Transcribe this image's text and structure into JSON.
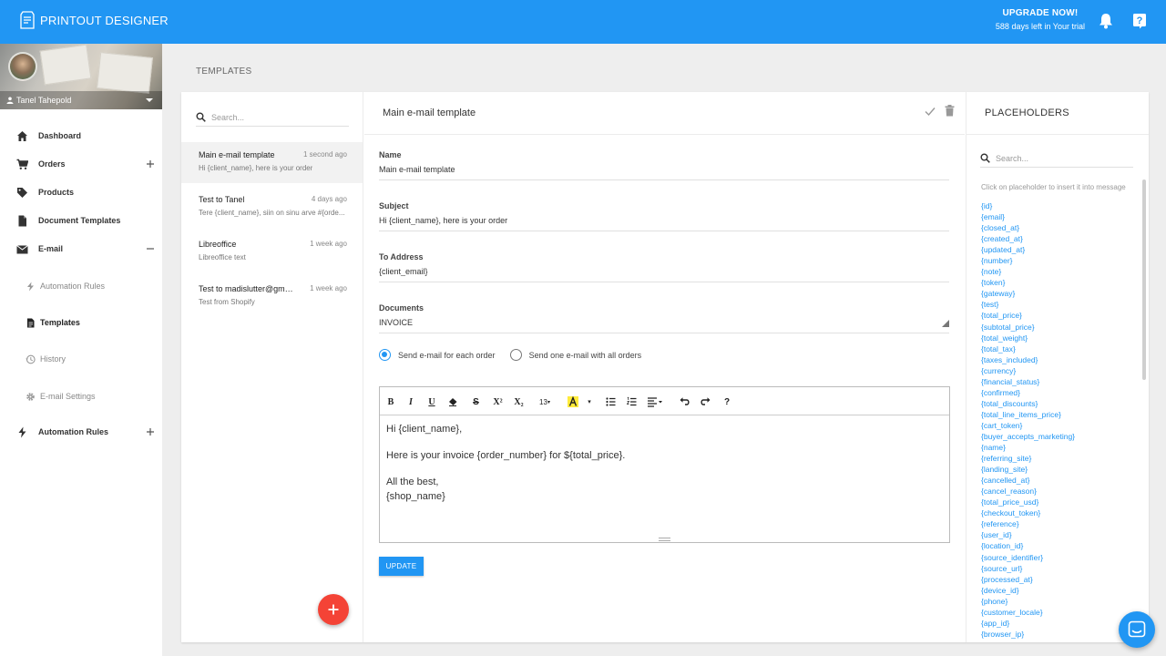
{
  "app": {
    "brand": "PRINTOUT DESIGNER",
    "upgrade_title": "UPGRADE NOW!",
    "upgrade_sub": "588 days left in Your trial"
  },
  "user": {
    "name": "Tanel Tahepold"
  },
  "sidebar": {
    "items": [
      {
        "label": "Dashboard",
        "icon": "home-icon"
      },
      {
        "label": "Orders",
        "icon": "cart-icon",
        "toggle": "+"
      },
      {
        "label": "Products",
        "icon": "tag-icon"
      },
      {
        "label": "Document Templates",
        "icon": "document-icon"
      },
      {
        "label": "E-mail",
        "icon": "mail-icon",
        "toggle": "−"
      },
      {
        "label": "Automation Rules",
        "icon": "bolt-icon"
      },
      {
        "label": "Templates",
        "icon": "file-icon"
      },
      {
        "label": "History",
        "icon": "history-icon"
      },
      {
        "label": "E-mail Settings",
        "icon": "gear-icon"
      },
      {
        "label": "Automation Rules",
        "icon": "bolt-icon",
        "toggle": "+"
      }
    ]
  },
  "page": {
    "title": "TEMPLATES"
  },
  "template_list": {
    "search_placeholder": "Search...",
    "items": [
      {
        "name": "Main e-mail template",
        "time": "1 second ago",
        "preview": "Hi {client_name}, here is your order"
      },
      {
        "name": "Test to Tanel",
        "time": "4 days ago",
        "preview": "Tere {client_name}, siin on sinu arve #{orde..."
      },
      {
        "name": "Libreoffice",
        "time": "1 week ago",
        "preview": "Libreoffice text"
      },
      {
        "name": "Test to madislutter@gmai...",
        "time": "1 week ago",
        "preview": "Test from Shopify"
      }
    ]
  },
  "editor": {
    "title": "Main e-mail template",
    "name_label": "Name",
    "name_value": "Main e-mail template",
    "subject_label": "Subject",
    "subject_value": "Hi {client_name}, here is your order",
    "to_label": "To Address",
    "to_value": "{client_email}",
    "documents_label": "Documents",
    "documents_value": "INVOICE",
    "radio_each": "Send e-mail for each order",
    "radio_all": "Send one e-mail with all orders",
    "toolbar": {
      "bold": "B",
      "italic": "I",
      "underline": "U",
      "strike": "S",
      "sup": "X²",
      "sub": "X₂",
      "font_size": "13",
      "help": "?"
    },
    "body": {
      "line1": "Hi {client_name},",
      "line2": "Here is your invoice {order_number} for ${total_price}.",
      "line3": "All the best,",
      "line4": "{shop_name}"
    },
    "update_label": "UPDATE"
  },
  "placeholders": {
    "title": "PLACEHOLDERS",
    "search_placeholder": "Search...",
    "hint": "Click on placeholder to insert it into message",
    "items": [
      "{id}",
      "{email}",
      "{closed_at}",
      "{created_at}",
      "{updated_at}",
      "{number}",
      "{note}",
      "{token}",
      "{gateway}",
      "{test}",
      "{total_price}",
      "{subtotal_price}",
      "{total_weight}",
      "{total_tax}",
      "{taxes_included}",
      "{currency}",
      "{financial_status}",
      "{confirmed}",
      "{total_discounts}",
      "{total_line_items_price}",
      "{cart_token}",
      "{buyer_accepts_marketing}",
      "{name}",
      "{referring_site}",
      "{landing_site}",
      "{cancelled_at}",
      "{cancel_reason}",
      "{total_price_usd}",
      "{checkout_token}",
      "{reference}",
      "{user_id}",
      "{location_id}",
      "{source_identifier}",
      "{source_url}",
      "{processed_at}",
      "{device_id}",
      "{phone}",
      "{customer_locale}",
      "{app_id}",
      "{browser_ip}"
    ]
  },
  "colors": {
    "primary": "#2196f3",
    "fab": "#f44336"
  }
}
